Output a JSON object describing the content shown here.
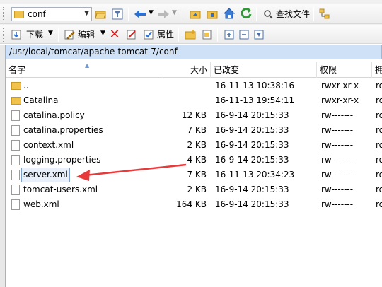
{
  "toolbar_top": {
    "location_value": "conf",
    "find_files_label": "查找文件"
  },
  "toolbar_bottom": {
    "download_label": "下载",
    "edit_label": "编辑",
    "properties_label": "属性"
  },
  "path": "/usr/local/tomcat/apache-tomcat-7/conf",
  "columns": {
    "name": "名字",
    "size": "大小",
    "modified": "已改变",
    "rights": "权限",
    "owner": "拥"
  },
  "files": [
    {
      "name": "..",
      "size": "",
      "modified": "16-11-13 10:38:16",
      "rights": "rwxr-xr-x",
      "owner": "ro",
      "type": "dir"
    },
    {
      "name": "Catalina",
      "size": "",
      "modified": "16-11-13 19:54:11",
      "rights": "rwxr-xr-x",
      "owner": "ro",
      "type": "dir"
    },
    {
      "name": "catalina.policy",
      "size": "12 KB",
      "modified": "16-9-14 20:15:33",
      "rights": "rw-------",
      "owner": "ro",
      "type": "file"
    },
    {
      "name": "catalina.properties",
      "size": "7 KB",
      "modified": "16-9-14 20:15:33",
      "rights": "rw-------",
      "owner": "ro",
      "type": "file"
    },
    {
      "name": "context.xml",
      "size": "2 KB",
      "modified": "16-9-14 20:15:33",
      "rights": "rw-------",
      "owner": "ro",
      "type": "file"
    },
    {
      "name": "logging.properties",
      "size": "4 KB",
      "modified": "16-9-14 20:15:33",
      "rights": "rw-------",
      "owner": "ro",
      "type": "file"
    },
    {
      "name": "server.xml",
      "size": "7 KB",
      "modified": "16-11-13 20:34:23",
      "rights": "rw-------",
      "owner": "ro",
      "type": "file",
      "selected": true
    },
    {
      "name": "tomcat-users.xml",
      "size": "2 KB",
      "modified": "16-9-14 20:15:33",
      "rights": "rw-------",
      "owner": "ro",
      "type": "file"
    },
    {
      "name": "web.xml",
      "size": "164 KB",
      "modified": "16-9-14 20:15:33",
      "rights": "rw-------",
      "owner": "ro",
      "type": "file"
    }
  ],
  "annotation": {
    "color": "#e83a3a",
    "points_to": "server.xml"
  },
  "colors": {
    "path_bar": "#cfe1f6",
    "selection_border": "#7da2ce",
    "arrow": "#e83a3a"
  }
}
